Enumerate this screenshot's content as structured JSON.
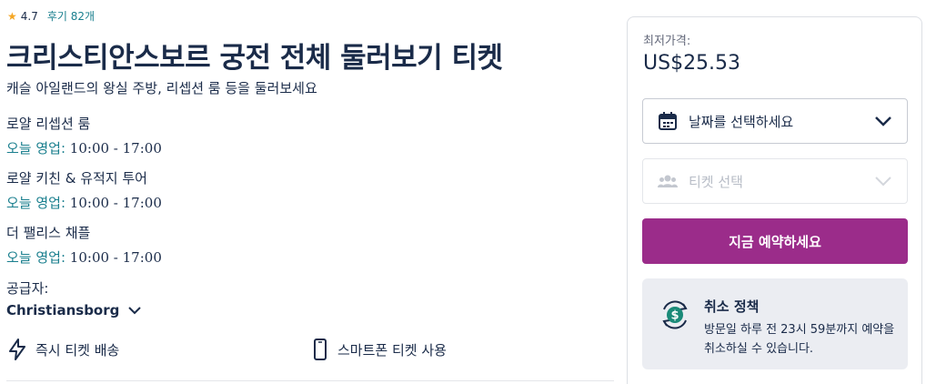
{
  "rating": {
    "score": "4.7",
    "reviews": "후기 82개"
  },
  "product": {
    "title": "크리스티안스보르 궁전 전체 둘러보기 티켓",
    "subtitle": "캐슬 아일랜드의 왕실 주방, 리셉션 룸 등을 둘러보세요"
  },
  "venues": [
    {
      "name": "로얄 리셉션 룸",
      "hours_label": "오늘 영업:",
      "hours": " 10:00 - 17:00"
    },
    {
      "name": "로얄 키친 & 유적지 투어",
      "hours_label": "오늘 영업:",
      "hours": " 10:00 - 17:00"
    },
    {
      "name": "더 팰리스 채플",
      "hours_label": "오늘 영업:",
      "hours": " 10:00 - 17:00"
    }
  ],
  "supplier": {
    "label": "공급자:",
    "name": "Christiansborg"
  },
  "features": [
    {
      "label": "즉시 티켓 배송",
      "icon": "lightning-icon"
    },
    {
      "label": "스마트폰 티켓 사용",
      "icon": "smartphone-icon"
    }
  ],
  "booking": {
    "price_label": "최저가격:",
    "price": "US$25.53",
    "date_select": "날짜를 선택하세요",
    "ticket_select": "티켓 선택",
    "book_button": "지금 예약하세요",
    "policy_title": "취소 정책",
    "policy_desc": "방문일 하루 전 23시 59분까지 예약을 취소하실 수 있습니다."
  },
  "colors": {
    "accent": "#9b2c8a",
    "teal": "#1a7f8e",
    "star": "#f5a623",
    "policy_icon": "#1a8a78"
  }
}
